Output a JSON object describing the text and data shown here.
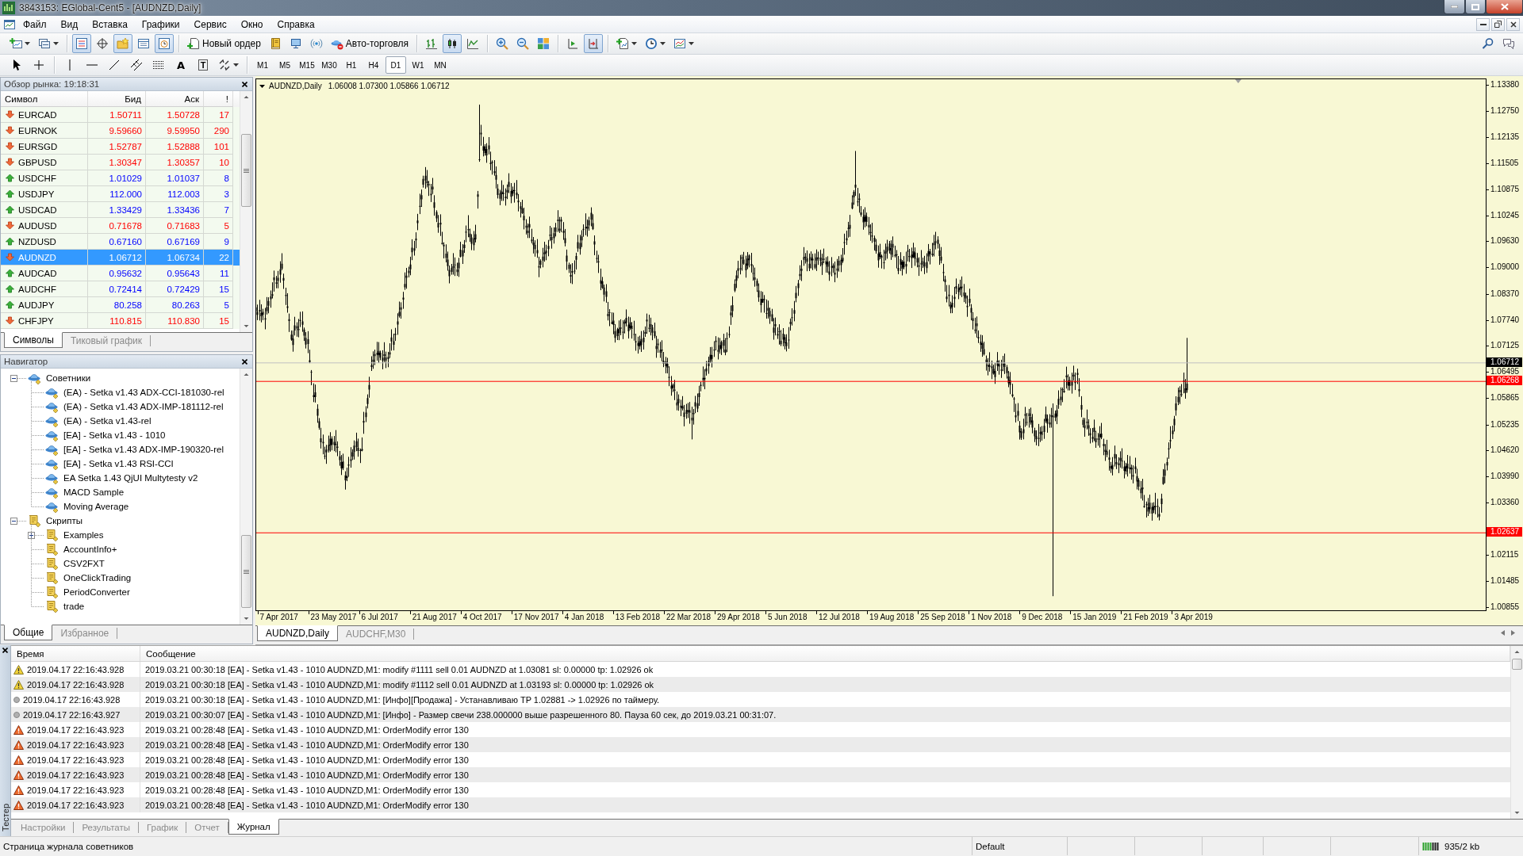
{
  "window": {
    "title": "3843153: EGlobal-Cent5 - [AUDNZD,Daily]"
  },
  "menu": [
    "Файл",
    "Вид",
    "Вставка",
    "Графики",
    "Сервис",
    "Окно",
    "Справка"
  ],
  "toolbar": {
    "groups": [
      [
        {
          "on": false
        },
        {
          "on": false
        }
      ],
      [
        {
          "on": true
        },
        {
          "on": false
        },
        {
          "on": true
        },
        {
          "on": false
        },
        {
          "on": true
        }
      ],
      [
        {
          "label": "Новый ордер",
          "on": false
        },
        {
          "on": false
        },
        {
          "on": false
        },
        {
          "on": false
        },
        {
          "label": "Авто-торговля",
          "on": false
        }
      ],
      [
        {
          "on": false
        },
        {
          "on": true
        },
        {
          "on": false
        }
      ],
      [
        {
          "on": false
        },
        {
          "on": false
        },
        {
          "on": false
        }
      ],
      [
        {
          "on": false
        },
        {
          "on": true
        }
      ],
      [
        {
          "on": false
        },
        {
          "on": false
        },
        {
          "on": false
        }
      ]
    ]
  },
  "drawing_toolbar": {
    "text_tool": "A",
    "label_tool": "T",
    "periods": [
      {
        "label": "M1",
        "selected": false
      },
      {
        "label": "M5",
        "selected": false
      },
      {
        "label": "M15",
        "selected": false
      },
      {
        "label": "M30",
        "selected": false
      },
      {
        "label": "H1",
        "selected": false
      },
      {
        "label": "H4",
        "selected": false
      },
      {
        "label": "D1",
        "selected": true
      },
      {
        "label": "W1",
        "selected": false
      },
      {
        "label": "MN",
        "selected": false
      }
    ]
  },
  "market_watch": {
    "title": "Обзор рынка: 19:18:31",
    "columns": [
      "Символ",
      "Бид",
      "Аск",
      "!"
    ],
    "rows": [
      {
        "symbol": "EURCAD",
        "bid": "1.50711",
        "ask": "1.50728",
        "spread": "17",
        "rising": false,
        "selected": false
      },
      {
        "symbol": "EURNOK",
        "bid": "9.59660",
        "ask": "9.59950",
        "spread": "290",
        "rising": false,
        "selected": false
      },
      {
        "symbol": "EURSGD",
        "bid": "1.52787",
        "ask": "1.52888",
        "spread": "101",
        "rising": false,
        "selected": false
      },
      {
        "symbol": "GBPUSD",
        "bid": "1.30347",
        "ask": "1.30357",
        "spread": "10",
        "rising": false,
        "selected": false
      },
      {
        "symbol": "USDCHF",
        "bid": "1.01029",
        "ask": "1.01037",
        "spread": "8",
        "rising": true,
        "selected": false
      },
      {
        "symbol": "USDJPY",
        "bid": "112.000",
        "ask": "112.003",
        "spread": "3",
        "rising": true,
        "selected": false
      },
      {
        "symbol": "USDCAD",
        "bid": "1.33429",
        "ask": "1.33436",
        "spread": "7",
        "rising": true,
        "selected": false
      },
      {
        "symbol": "AUDUSD",
        "bid": "0.71678",
        "ask": "0.71683",
        "spread": "5",
        "rising": false,
        "selected": false
      },
      {
        "symbol": "NZDUSD",
        "bid": "0.67160",
        "ask": "0.67169",
        "spread": "9",
        "rising": true,
        "selected": false
      },
      {
        "symbol": "AUDNZD",
        "bid": "1.06712",
        "ask": "1.06734",
        "spread": "22",
        "rising": false,
        "selected": true
      },
      {
        "symbol": "AUDCAD",
        "bid": "0.95632",
        "ask": "0.95643",
        "spread": "11",
        "rising": true,
        "selected": false
      },
      {
        "symbol": "AUDCHF",
        "bid": "0.72414",
        "ask": "0.72429",
        "spread": "15",
        "rising": true,
        "selected": false
      },
      {
        "symbol": "AUDJPY",
        "bid": "80.258",
        "ask": "80.263",
        "spread": "5",
        "rising": true,
        "selected": false
      },
      {
        "symbol": "CHFJPY",
        "bid": "110.815",
        "ask": "110.830",
        "spread": "15",
        "rising": false,
        "selected": false
      }
    ],
    "tabs": [
      {
        "label": "Символы",
        "selected": true
      },
      {
        "label": "Тиковый график",
        "selected": false
      }
    ]
  },
  "navigator": {
    "title": "Навигатор",
    "tree": [
      {
        "label": "Советники",
        "kind": "expert",
        "expanded": true,
        "children": [
          {
            "label": "(EA) - Setka v1.43 ADX-CCI-181030-rel",
            "kind": "expert"
          },
          {
            "label": "(EA) - Setka v1.43 ADX-IMP-181112-rel",
            "kind": "expert"
          },
          {
            "label": "(EA) - Setka v1.43-rel",
            "kind": "expert"
          },
          {
            "label": "[EA] - Setka v1.43 - 1010",
            "kind": "expert"
          },
          {
            "label": "[EA] - Setka v1.43 ADX-IMP-190320-rel",
            "kind": "expert"
          },
          {
            "label": "[EA] - Setka v1.43 RSI-CCI",
            "kind": "expert"
          },
          {
            "label": "EA Setka 1.43 QjUI Multytesty v2",
            "kind": "expert"
          },
          {
            "label": "MACD Sample",
            "kind": "expert"
          },
          {
            "label": "Moving Average",
            "kind": "expert"
          }
        ]
      },
      {
        "label": "Скрипты",
        "kind": "script",
        "expanded": true,
        "children": [
          {
            "label": "Examples",
            "kind": "script",
            "expanded": false
          },
          {
            "label": "AccountInfo+",
            "kind": "script"
          },
          {
            "label": "CSV2FXT",
            "kind": "script"
          },
          {
            "label": "OneClickTrading",
            "kind": "script"
          },
          {
            "label": "PeriodConverter",
            "kind": "script"
          },
          {
            "label": "trade",
            "kind": "script"
          }
        ]
      }
    ],
    "tabs": [
      {
        "label": "Общие",
        "selected": true
      },
      {
        "label": "Избранное",
        "selected": false
      }
    ]
  },
  "chart": {
    "symbol": "AUDNZD,Daily",
    "ohlc": "1.06008 1.07300 1.05866 1.06712",
    "price_ticks": [
      "1.13380",
      "1.12750",
      "1.12135",
      "1.11505",
      "1.10875",
      "1.10245",
      "1.09630",
      "1.09000",
      "1.08370",
      "1.07740",
      "1.07125",
      "1.06495",
      "1.05865",
      "1.05235",
      "1.04620",
      "1.03990",
      "1.03360",
      "1.02115",
      "1.01485",
      "1.00855"
    ],
    "bid": "1.06712",
    "levels": [
      "1.06268",
      "1.02637"
    ],
    "dates": [
      "7 Apr 2017",
      "23 May 2017",
      "6 Jul 2017",
      "21 Aug 2017",
      "4 Oct 2017",
      "17 Nov 2017",
      "4 Jan 2018",
      "13 Feb 2018",
      "22 Mar 2018",
      "29 Apr 2018",
      "5 Jun 2018",
      "12 Jul 2018",
      "19 Aug 2018",
      "25 Sep 2018",
      "1 Nov 2018",
      "9 Dec 2018",
      "15 Jan 2019",
      "21 Feb 2019",
      "3 Apr 2019"
    ],
    "tabs": [
      {
        "label": "AUDNZD,Daily",
        "selected": true
      },
      {
        "label": "AUDCHF,M30",
        "selected": false
      }
    ]
  },
  "tester": {
    "label": "Тестер",
    "columns": [
      "Время",
      "Сообщение"
    ],
    "rows": [
      {
        "kind": "warning",
        "time": "2019.04.17 22:16:43.928",
        "message": "2019.03.21 00:30:18 [EA] - Setka v1.43 - 1010 AUDNZD,M1: modify #1111 sell 0.01 AUDNZD at 1.03081 sl: 0.00000 tp: 1.02926 ok"
      },
      {
        "kind": "warning",
        "time": "2019.04.17 22:16:43.928",
        "message": "2019.03.21 00:30:18 [EA] - Setka v1.43 - 1010 AUDNZD,M1: modify #1112 sell 0.01 AUDNZD at 1.03193 sl: 0.00000 tp: 1.02926 ok"
      },
      {
        "kind": "info",
        "time": "2019.04.17 22:16:43.928",
        "message": "2019.03.21 00:30:18 [EA] - Setka v1.43 - 1010 AUDNZD,M1: [Инфо][Продажа] - Устанавливаю TP 1.02881 -> 1.02926 по таймеру."
      },
      {
        "kind": "info",
        "time": "2019.04.17 22:16:43.927",
        "message": "2019.03.21 00:30:07 [EA] - Setka v1.43 - 1010 AUDNZD,M1: [Инфо] - Размер свечи 238.000000 выше разрешенного 80. Пауза 60 сек, до 2019.03.21 00:31:07."
      },
      {
        "kind": "error",
        "time": "2019.04.17 22:16:43.923",
        "message": "2019.03.21 00:28:48 [EA] - Setka v1.43 - 1010 AUDNZD,M1: OrderModify error 130"
      },
      {
        "kind": "error",
        "time": "2019.04.17 22:16:43.923",
        "message": "2019.03.21 00:28:48 [EA] - Setka v1.43 - 1010 AUDNZD,M1: OrderModify error 130"
      },
      {
        "kind": "error",
        "time": "2019.04.17 22:16:43.923",
        "message": "2019.03.21 00:28:48 [EA] - Setka v1.43 - 1010 AUDNZD,M1: OrderModify error 130"
      },
      {
        "kind": "error",
        "time": "2019.04.17 22:16:43.923",
        "message": "2019.03.21 00:28:48 [EA] - Setka v1.43 - 1010 AUDNZD,M1: OrderModify error 130"
      },
      {
        "kind": "error",
        "time": "2019.04.17 22:16:43.923",
        "message": "2019.03.21 00:28:48 [EA] - Setka v1.43 - 1010 AUDNZD,M1: OrderModify error 130"
      },
      {
        "kind": "error",
        "time": "2019.04.17 22:16:43.923",
        "message": "2019.03.21 00:28:48 [EA] - Setka v1.43 - 1010 AUDNZD,M1: OrderModify error 130"
      }
    ],
    "tabs": [
      {
        "label": "Настройки",
        "selected": false
      },
      {
        "label": "Результаты",
        "selected": false
      },
      {
        "label": "График",
        "selected": false
      },
      {
        "label": "Отчет",
        "selected": false
      },
      {
        "label": "Журнал",
        "selected": true
      }
    ]
  },
  "status_bar": {
    "message": "Страница журнала советников",
    "profile": "Default",
    "traffic": "935/2 kb"
  }
}
